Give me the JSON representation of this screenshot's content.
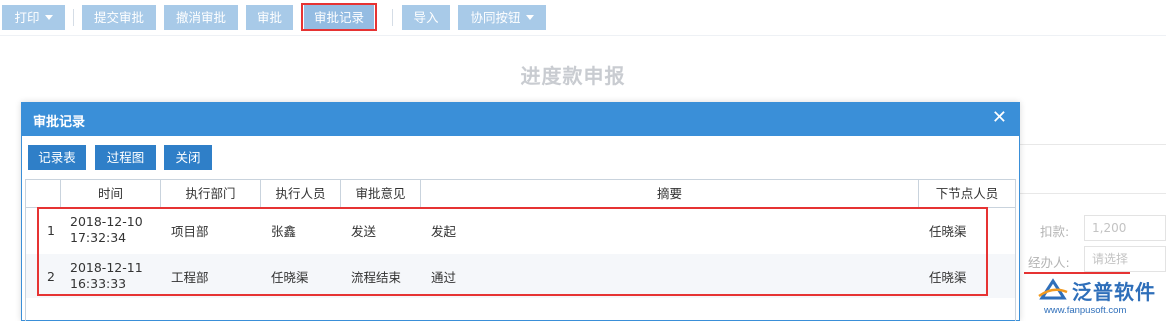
{
  "toolbar": {
    "print": "打印",
    "submit": "提交审批",
    "cancel": "撤消审批",
    "approve": "审批",
    "approval_record": "审批记录",
    "import": "导入",
    "collab": "协同按钮"
  },
  "page": {
    "title": "进度款申报"
  },
  "background_form": {
    "deduction_label": "扣款:",
    "deduction_value": "1,200",
    "handler_label": "经办人:",
    "handler_placeholder": "请选择"
  },
  "logo": {
    "name": "泛普软件",
    "url": "www.fanpusoft.com"
  },
  "modal": {
    "title": "审批记录",
    "buttons": {
      "record_table": "记录表",
      "process_chart": "过程图",
      "close": "关闭"
    },
    "columns": [
      "",
      "时间",
      "执行部门",
      "执行人员",
      "审批意见",
      "摘要",
      "下节点人员"
    ],
    "rows": [
      {
        "no": "1",
        "date": "2018-12-10",
        "time": "17:32:34",
        "dept": "项目部",
        "person": "张鑫",
        "opinion": "发送",
        "summary": "发起",
        "next": "任晓渠"
      },
      {
        "no": "2",
        "date": "2018-12-11",
        "time": "16:33:33",
        "dept": "工程部",
        "person": "任晓渠",
        "opinion": "流程结束",
        "summary": "通过",
        "next": "任晓渠"
      }
    ]
  },
  "colors": {
    "header_blue": "#3a8fd8",
    "button_blue": "#2f7fc8",
    "toolbar_button": "#a8cae8",
    "highlight_red": "#e63333"
  }
}
